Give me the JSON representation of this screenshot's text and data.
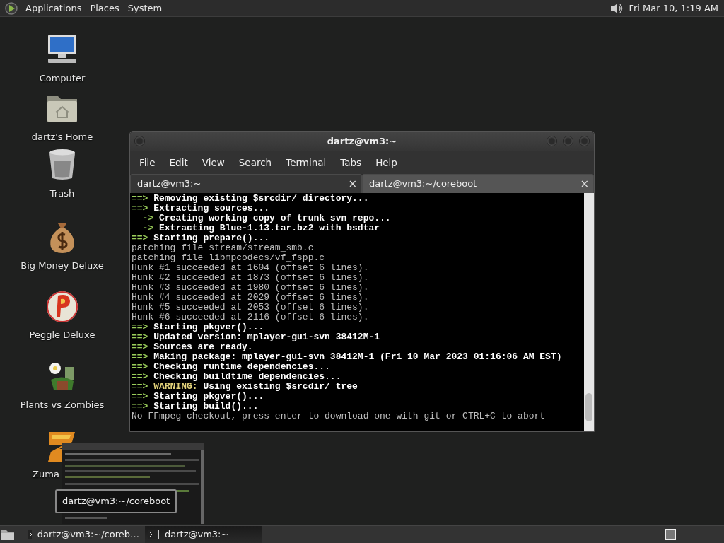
{
  "top_panel": {
    "menus": [
      "Applications",
      "Places",
      "System"
    ],
    "clock": "Fri Mar 10,  1:19 AM"
  },
  "desktop_icons": [
    {
      "label": "Computer",
      "kind": "computer"
    },
    {
      "label": "dartz's Home",
      "kind": "home"
    },
    {
      "label": "Trash",
      "kind": "trash"
    },
    {
      "label": "Big Money Deluxe",
      "kind": "money"
    },
    {
      "label": "Peggle Deluxe",
      "kind": "peggle"
    },
    {
      "label": "Plants vs Zombies",
      "kind": "plants"
    },
    {
      "label": "Zuma",
      "kind": "zuma"
    }
  ],
  "terminal": {
    "title": "dartz@vm3:~",
    "menu": [
      "File",
      "Edit",
      "View",
      "Search",
      "Terminal",
      "Tabs",
      "Help"
    ],
    "tabs": [
      {
        "label": "dartz@vm3:~",
        "selected": true,
        "close": "×"
      },
      {
        "label": "dartz@vm3:~/coreboot",
        "selected": false,
        "close": "×"
      }
    ],
    "lines": [
      {
        "kind": "step",
        "prefix": "==>",
        "text": "Removing existing $srcdir/ directory..."
      },
      {
        "kind": "step",
        "prefix": "==>",
        "text": "Extracting sources..."
      },
      {
        "kind": "sub",
        "prefix": "->",
        "text": "Creating working copy of trunk svn repo..."
      },
      {
        "kind": "sub",
        "prefix": "->",
        "text": "Extracting Blue-1.13.tar.bz2 with bsdtar"
      },
      {
        "kind": "step",
        "prefix": "==>",
        "text": "Starting prepare()..."
      },
      {
        "kind": "plain",
        "text": "patching file stream/stream_smb.c"
      },
      {
        "kind": "plain",
        "text": "patching file libmpcodecs/vf_fspp.c"
      },
      {
        "kind": "plain",
        "text": "Hunk #1 succeeded at 1604 (offset 6 lines)."
      },
      {
        "kind": "plain",
        "text": "Hunk #2 succeeded at 1873 (offset 6 lines)."
      },
      {
        "kind": "plain",
        "text": "Hunk #3 succeeded at 1980 (offset 6 lines)."
      },
      {
        "kind": "plain",
        "text": "Hunk #4 succeeded at 2029 (offset 6 lines)."
      },
      {
        "kind": "plain",
        "text": "Hunk #5 succeeded at 2053 (offset 6 lines)."
      },
      {
        "kind": "plain",
        "text": "Hunk #6 succeeded at 2116 (offset 6 lines)."
      },
      {
        "kind": "step",
        "prefix": "==>",
        "text": "Starting pkgver()..."
      },
      {
        "kind": "step",
        "prefix": "==>",
        "text": "Updated version: mplayer-gui-svn 38412M-1"
      },
      {
        "kind": "step",
        "prefix": "==>",
        "text": "Sources are ready."
      },
      {
        "kind": "step",
        "prefix": "==>",
        "text": "Making package: mplayer-gui-svn 38412M-1 (Fri 10 Mar 2023 01:16:06 AM EST)"
      },
      {
        "kind": "step",
        "prefix": "==>",
        "text": "Checking runtime dependencies..."
      },
      {
        "kind": "step",
        "prefix": "==>",
        "text": "Checking buildtime dependencies..."
      },
      {
        "kind": "warning",
        "prefix": "==>",
        "tag": "WARNING:",
        "text": "Using existing $srcdir/ tree"
      },
      {
        "kind": "step",
        "prefix": "==>",
        "text": "Starting pkgver()..."
      },
      {
        "kind": "step",
        "prefix": "==>",
        "text": "Starting build()..."
      },
      {
        "kind": "plain",
        "text": "No FFmpeg checkout, press enter to download one with git or CTRL+C to abort"
      }
    ]
  },
  "tooltip": "dartz@vm3:~/coreboot",
  "taskbar": {
    "items": [
      {
        "label": "dartz@vm3:~/coreb…",
        "selected": false
      },
      {
        "label": "dartz@vm3:~",
        "selected": true
      }
    ]
  }
}
